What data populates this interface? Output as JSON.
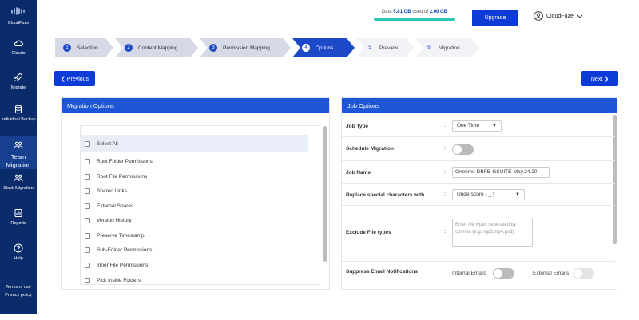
{
  "sidebar": {
    "logo_text": "CloudFuze",
    "items": [
      {
        "label": "Clouds",
        "icon": "cloud-icon"
      },
      {
        "label": "Migrate",
        "icon": "rocket-icon"
      },
      {
        "label": "Individual Backup",
        "icon": "database-icon"
      },
      {
        "label": "Team Migration",
        "icon": "team-icon",
        "active": true
      },
      {
        "label": "Slack Migration",
        "icon": "team-icon"
      },
      {
        "label": "Reports",
        "icon": "report-icon"
      },
      {
        "label": "Help",
        "icon": "help-icon"
      }
    ],
    "footer_links": [
      "Terms of use",
      "Privacy policy"
    ]
  },
  "header": {
    "storage_prefix": "Data",
    "storage_used": "5.81 GB",
    "storage_mid": "used of",
    "storage_total": "2.00 GB",
    "upgrade_label": "Upgrade",
    "user_name": "CloudFuze"
  },
  "steps": [
    {
      "num": "1",
      "label": "Selection",
      "state": "done"
    },
    {
      "num": "2",
      "label": "Content Mapping",
      "state": "done"
    },
    {
      "num": "3",
      "label": "Permission Mapping",
      "state": "done"
    },
    {
      "num": "4",
      "label": "Options",
      "state": "active"
    },
    {
      "num": "5",
      "label": "Preview",
      "state": "future"
    },
    {
      "num": "6",
      "label": "Migration",
      "state": "future"
    }
  ],
  "nav": {
    "previous_label": "Previous",
    "next_label": "Next"
  },
  "migration_options": {
    "title": "Migration Options",
    "select_all": "Select All",
    "options": [
      "Root Folder Permissons",
      "Root File Permissions",
      "Shared Links",
      "External Shares",
      "Version History",
      "Preserve Timestamp",
      "Sub-Folder Permissions",
      "Inner File Permissions",
      "Pick Inside Folders"
    ]
  },
  "job_options": {
    "title": "Job Options",
    "job_type_label": "Job Type",
    "job_type_value": "One Time",
    "schedule_label": "Schedule Migration",
    "job_name_label": "Job Name",
    "job_name_value": "Onetime-DBFB-GSUITE-May.24.20",
    "replace_label": "Replace special characters with",
    "replace_value": "Underscore ( _ )",
    "exclude_label": "Exclude File types",
    "exclude_placeholder": "Enter file types seperated by comma (e.g. mp3,mp4,psd)",
    "suppress_label": "Suppress Email Notifications",
    "internal_label": "Internal Emails",
    "external_label": "External Emails"
  }
}
